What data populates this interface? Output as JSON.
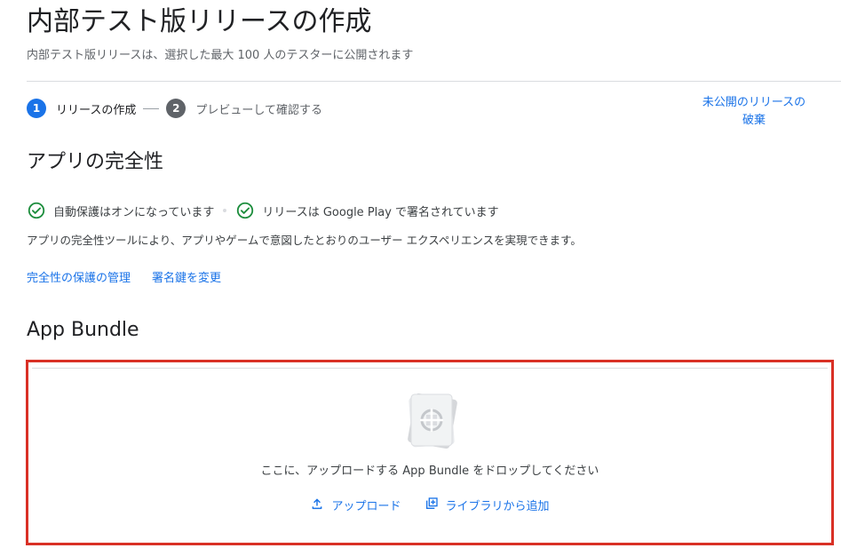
{
  "header": {
    "title": "内部テスト版リリースの作成",
    "subtitle": "内部テスト版リリースは、選択した最大 100 人のテスターに公開されます"
  },
  "stepper": {
    "steps": [
      {
        "number": "1",
        "label": "リリースの作成",
        "state": "active"
      },
      {
        "number": "2",
        "label": "プレビューして確認する",
        "state": "inactive"
      }
    ],
    "discard_label_line1": "未公開のリリースの",
    "discard_label_line2": "破棄"
  },
  "integrity": {
    "title": "アプリの完全性",
    "statuses": [
      {
        "icon": "check-circle-icon",
        "label": "自動保護はオンになっています"
      },
      {
        "icon": "check-circle-icon",
        "label": "リリースは Google Play で署名されています"
      }
    ],
    "description": "アプリの完全性ツールにより、アプリやゲームで意図したとおりのユーザー エクスペリエンスを実現できます。",
    "links": {
      "manage_protection": "完全性の保護の管理",
      "change_signing_key": "署名鍵を変更"
    }
  },
  "app_bundle": {
    "title": "App Bundle",
    "drop_text": "ここに、アップロードする App Bundle をドロップしてください",
    "upload_label": "アップロード",
    "add_from_library_label": "ライブラリから追加"
  },
  "colors": {
    "accent": "#1a73e8",
    "success": "#1e8e3e",
    "highlight_border": "#d93025"
  }
}
